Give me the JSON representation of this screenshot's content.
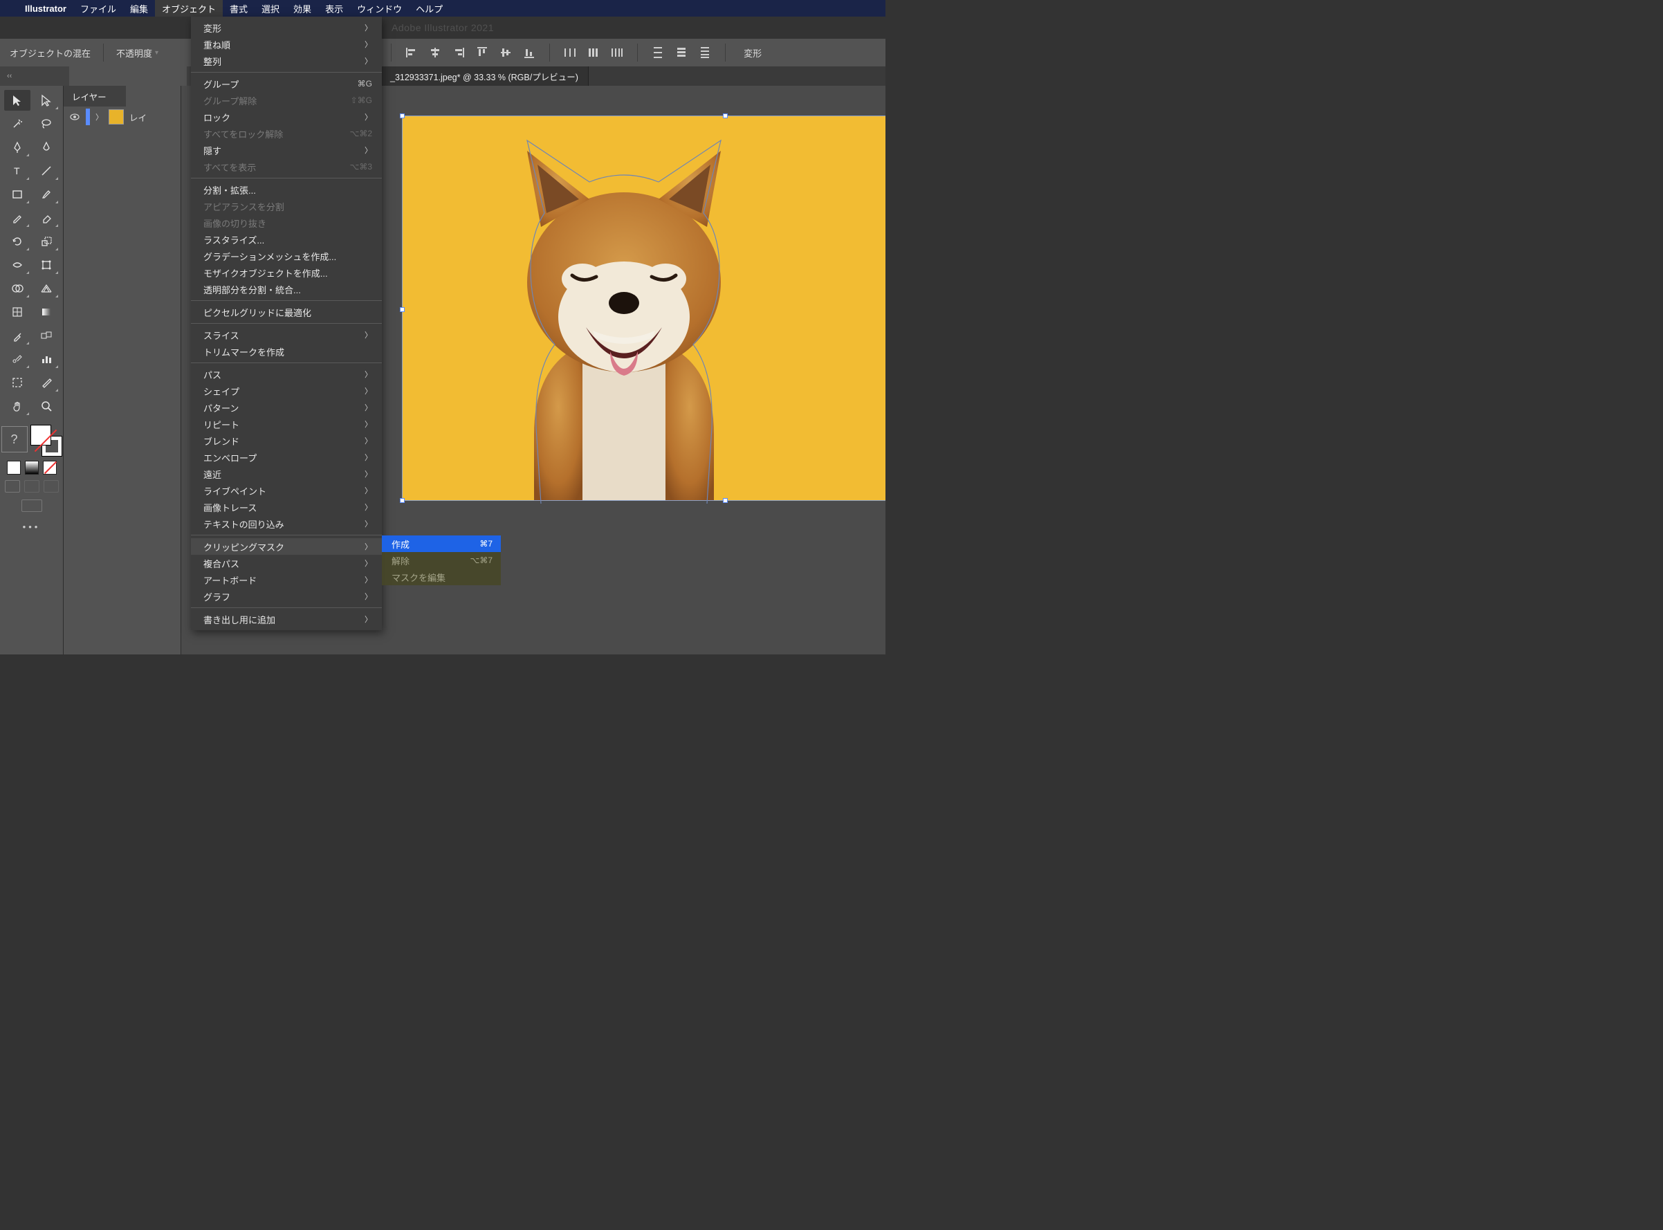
{
  "menubar": {
    "app": "Illustrator",
    "items": [
      "ファイル",
      "編集",
      "オブジェクト",
      "書式",
      "選択",
      "効果",
      "表示",
      "ウィンドウ",
      "ヘルプ"
    ],
    "active_index": 2
  },
  "appbar_title": "Adobe Illustrator 2021",
  "controlrow": {
    "left_label": "オブジェクトの混在",
    "opacity_label": "不透明度",
    "transform_label": "変形"
  },
  "tabrow": {
    "corner": "‹‹",
    "doctab": "_312933371.jpeg* @ 33.33 % (RGB/プレビュー)"
  },
  "layers": {
    "panel_title": "レイヤー",
    "row_name": "レイ"
  },
  "menu": {
    "groups": [
      [
        {
          "label": "変形",
          "sub": true
        },
        {
          "label": "重ね順",
          "sub": true
        },
        {
          "label": "整列",
          "sub": true
        }
      ],
      [
        {
          "label": "グループ",
          "shortcut": "⌘G"
        },
        {
          "label": "グループ解除",
          "shortcut": "⇧⌘G",
          "disabled": true
        },
        {
          "label": "ロック",
          "sub": true
        },
        {
          "label": "すべてをロック解除",
          "shortcut": "⌥⌘2",
          "disabled": true
        },
        {
          "label": "隠す",
          "sub": true
        },
        {
          "label": "すべてを表示",
          "shortcut": "⌥⌘3",
          "disabled": true
        }
      ],
      [
        {
          "label": "分割・拡張..."
        },
        {
          "label": "アピアランスを分割",
          "disabled": true
        },
        {
          "label": "画像の切り抜き",
          "disabled": true
        },
        {
          "label": "ラスタライズ..."
        },
        {
          "label": "グラデーションメッシュを作成..."
        },
        {
          "label": "モザイクオブジェクトを作成..."
        },
        {
          "label": "透明部分を分割・統合..."
        }
      ],
      [
        {
          "label": "ピクセルグリッドに最適化"
        }
      ],
      [
        {
          "label": "スライス",
          "sub": true
        },
        {
          "label": "トリムマークを作成"
        }
      ],
      [
        {
          "label": "パス",
          "sub": true
        },
        {
          "label": "シェイプ",
          "sub": true
        },
        {
          "label": "パターン",
          "sub": true
        },
        {
          "label": "リピート",
          "sub": true
        },
        {
          "label": "ブレンド",
          "sub": true
        },
        {
          "label": "エンベロープ",
          "sub": true
        },
        {
          "label": "遠近",
          "sub": true
        },
        {
          "label": "ライブペイント",
          "sub": true
        },
        {
          "label": "画像トレース",
          "sub": true
        },
        {
          "label": "テキストの回り込み",
          "sub": true
        }
      ],
      [
        {
          "label": "クリッピングマスク",
          "sub": true,
          "hover": true
        },
        {
          "label": "複合パス",
          "sub": true
        },
        {
          "label": "アートボード",
          "sub": true
        },
        {
          "label": "グラフ",
          "sub": true
        }
      ],
      [
        {
          "label": "書き出し用に追加",
          "sub": true
        }
      ]
    ]
  },
  "submenu": {
    "items": [
      {
        "label": "作成",
        "shortcut": "⌘7",
        "selected": true
      },
      {
        "label": "解除",
        "shortcut": "⌥⌘7",
        "disabled": true
      },
      {
        "label": "マスクを編集",
        "disabled": true
      }
    ]
  }
}
